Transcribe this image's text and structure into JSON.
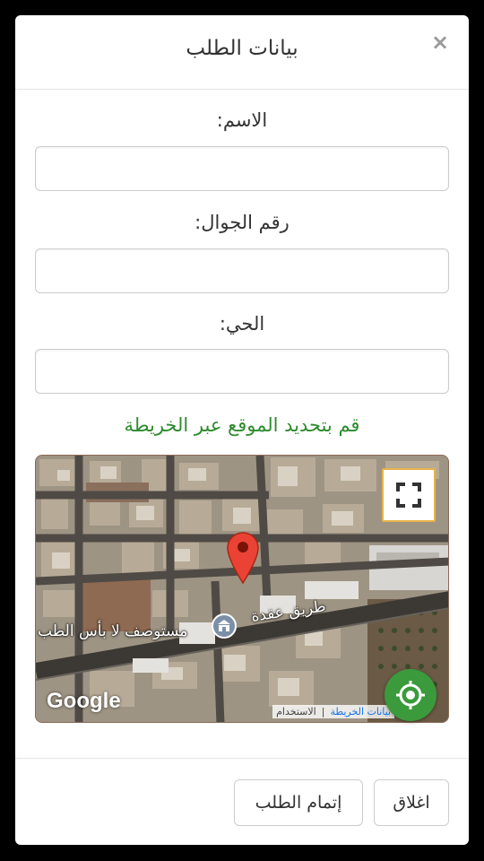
{
  "modal": {
    "title": "بيانات الطلب",
    "close_symbol": "×"
  },
  "form": {
    "name_label": ":الاسم",
    "name_value": "",
    "phone_label": ":رقم الجوال",
    "phone_value": "",
    "district_label": ":الحي",
    "district_value": "",
    "map_hint": "قم بتحديد الموقع عبر الخريطة"
  },
  "map": {
    "road_label": "طريق عقدة",
    "poi_label": "مستوصف لا بأس الطب",
    "google_logo": "Google",
    "attribution_data": "بيانات الخريطة",
    "attribution_terms": "الاستخدام",
    "pin_color": "#ea4335"
  },
  "footer": {
    "close_label": "اغلاق",
    "submit_label": "إتمام الطلب"
  },
  "colors": {
    "hint_green": "#2e8b2e",
    "locate_green": "#3b9a3b"
  }
}
